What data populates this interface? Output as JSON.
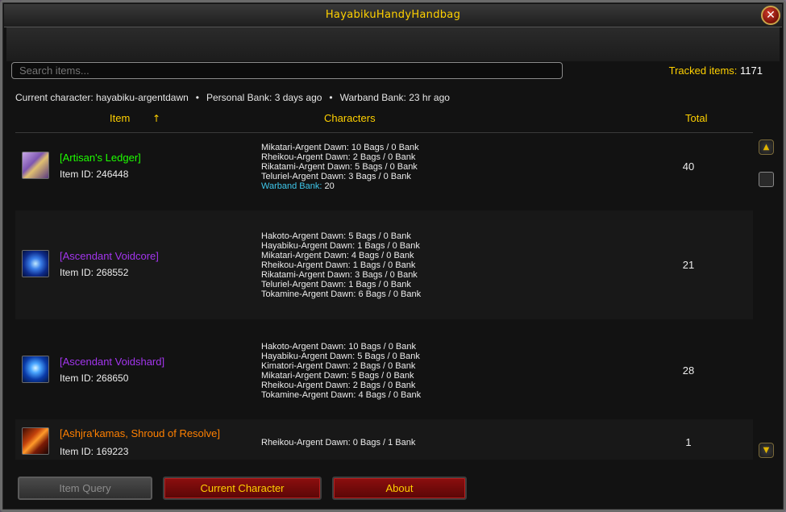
{
  "window": {
    "title": "HayabikuHandyHandbag",
    "close_label": "✕"
  },
  "search": {
    "placeholder": "Search items..."
  },
  "tracked": {
    "label": "Tracked items:",
    "value": "1171"
  },
  "status": {
    "current_character": "Current character: hayabiku-argentdawn",
    "personal_bank": "Personal Bank: 3 days ago",
    "warband_bank": "Warband Bank: 23 hr ago",
    "separator": "•"
  },
  "columns": {
    "item": "Item",
    "characters": "Characters",
    "total": "Total",
    "sort_icon": "↑"
  },
  "rows": [
    {
      "name": "[Artisan's Ledger]",
      "name_color": "#1eff00",
      "icon": "ledger-icon",
      "item_id": "Item ID: 246448",
      "characters": [
        "Mikatari-Argent Dawn: 10 Bags / 0 Bank",
        "Rheikou-Argent Dawn: 2 Bags / 0 Bank",
        "Rikatami-Argent Dawn: 5 Bags / 0 Bank",
        "Teluriel-Argent Dawn: 3 Bags / 0 Bank"
      ],
      "warband_label": "Warband Bank:",
      "warband_value": "20",
      "total": "40"
    },
    {
      "name": "[Ascendant Voidcore]",
      "name_color": "#a335ee",
      "icon": "voidcore-icon",
      "item_id": "Item ID: 268552",
      "characters": [
        "Hakoto-Argent Dawn: 5 Bags / 0 Bank",
        "Hayabiku-Argent Dawn: 1 Bags / 0 Bank",
        "Mikatari-Argent Dawn: 4 Bags / 0 Bank",
        "Rheikou-Argent Dawn: 1 Bags / 0 Bank",
        "Rikatami-Argent Dawn: 3 Bags / 0 Bank",
        "Teluriel-Argent Dawn: 1 Bags / 0 Bank",
        "Tokamine-Argent Dawn: 6 Bags / 0 Bank"
      ],
      "total": "21"
    },
    {
      "name": "[Ascendant Voidshard]",
      "name_color": "#a335ee",
      "icon": "voidshard-icon",
      "item_id": "Item ID: 268650",
      "characters": [
        "Hakoto-Argent Dawn: 10 Bags / 0 Bank",
        "Hayabiku-Argent Dawn: 5 Bags / 0 Bank",
        "Kimatori-Argent Dawn: 2 Bags / 0 Bank",
        "Mikatari-Argent Dawn: 5 Bags / 0 Bank",
        "Rheikou-Argent Dawn: 2 Bags / 0 Bank",
        "Tokamine-Argent Dawn: 4 Bags / 0 Bank"
      ],
      "total": "28"
    },
    {
      "name": "[Ashjra'kamas, Shroud of Resolve]",
      "name_color": "#ff8000",
      "icon": "cloak-icon",
      "item_id": "Item ID: 169223",
      "characters": [
        "Rheikou-Argent Dawn: 0 Bags / 1 Bank"
      ],
      "total": "1"
    }
  ],
  "buttons": {
    "item_query": "Item Query",
    "current_character": "Current Character",
    "about": "About"
  },
  "scrollbar": {
    "up_icon": "▲",
    "down_icon": "▼"
  }
}
